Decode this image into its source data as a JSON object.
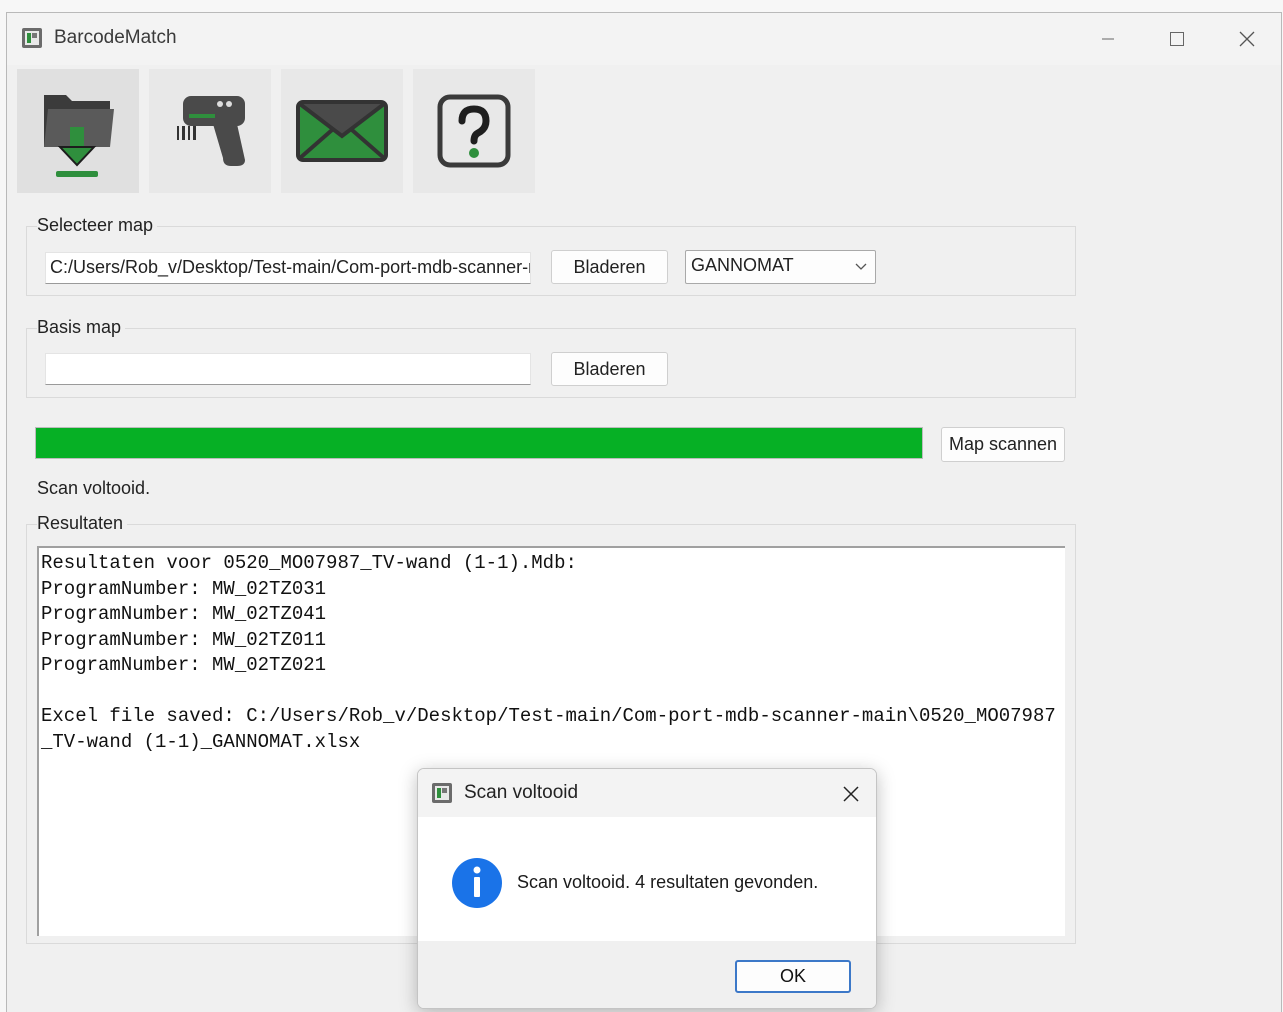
{
  "window": {
    "title": "BarcodeMatch"
  },
  "toolbar": {
    "tabs": [
      {
        "icon": "folder-download-icon",
        "active": true
      },
      {
        "icon": "barcode-scanner-icon",
        "active": false
      },
      {
        "icon": "envelope-icon",
        "active": false
      },
      {
        "icon": "help-icon",
        "active": false
      }
    ]
  },
  "select_folder": {
    "label": "Selecteer map",
    "path_value": "C:/Users/Rob_v/Desktop/Test-main/Com-port-mdb-scanner-main",
    "browse_label": "Bladeren",
    "machine_selected": "GANNOMAT"
  },
  "base_folder": {
    "label": "Basis map",
    "path_value": "",
    "browse_label": "Bladeren"
  },
  "scan": {
    "progress": 1.0,
    "button_label": "Map scannen",
    "status": "Scan voltooid."
  },
  "results": {
    "label": "Resultaten",
    "text": "Resultaten voor 0520_MO07987_TV-wand (1-1).Mdb:\nProgramNumber: MW_02TZ031\nProgramNumber: MW_02TZ041\nProgramNumber: MW_02TZ011\nProgramNumber: MW_02TZ021\n\nExcel file saved: C:/Users/Rob_v/Desktop/Test-main/Com-port-mdb-scanner-main\\0520_MO07987_TV-wand (1-1)_GANNOMAT.xlsx"
  },
  "dialog": {
    "title": "Scan voltooid",
    "message": "Scan voltooid. 4 resultaten gevonden.",
    "ok_label": "OK"
  },
  "colors": {
    "progress_fill": "#06b025",
    "info_blue": "#1a73e8"
  }
}
